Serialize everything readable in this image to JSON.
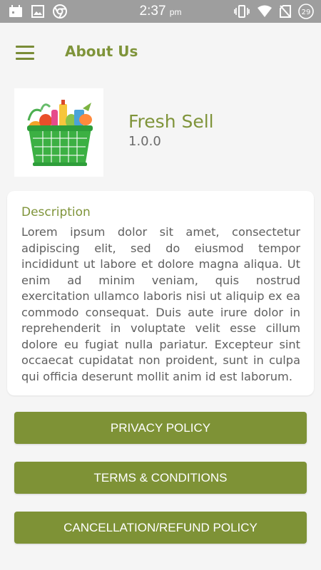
{
  "status_bar": {
    "time": "2:37",
    "time_suffix": "pm",
    "battery_level": "29",
    "icons": [
      "calendar-notification-icon",
      "image-notification-icon",
      "chrome-icon",
      "vibrate-icon",
      "wifi-icon",
      "no-sim-icon",
      "battery-icon"
    ]
  },
  "app_bar": {
    "title": "About Us",
    "menu_icon": "hamburger-menu-icon"
  },
  "app_info": {
    "name": "Fresh Sell",
    "version": "1.0.0",
    "logo": "grocery-basket-logo"
  },
  "description": {
    "title": "Description",
    "text": "Lorem ipsum dolor sit amet, consectetur adipiscing elit, sed do eiusmod tempor incididunt ut labore et dolore magna aliqua. Ut enim ad minim veniam, quis nostrud exercitation ullamco laboris nisi ut aliquip ex ea commodo consequat. Duis aute irure dolor in reprehenderit in voluptate velit esse cillum dolore eu fugiat nulla pariatur. Excepteur sint occaecat cupidatat non proident, sunt in culpa qui officia deserunt mollit anim id est laborum."
  },
  "buttons": {
    "privacy": "PRIVACY POLICY",
    "terms": "TERMS & CONDITIONS",
    "refund": "CANCELLATION/REFUND POLICY"
  },
  "colors": {
    "accent": "#7e9236",
    "status_bar": "#9e9e9e",
    "background": "#f5f5f5"
  }
}
